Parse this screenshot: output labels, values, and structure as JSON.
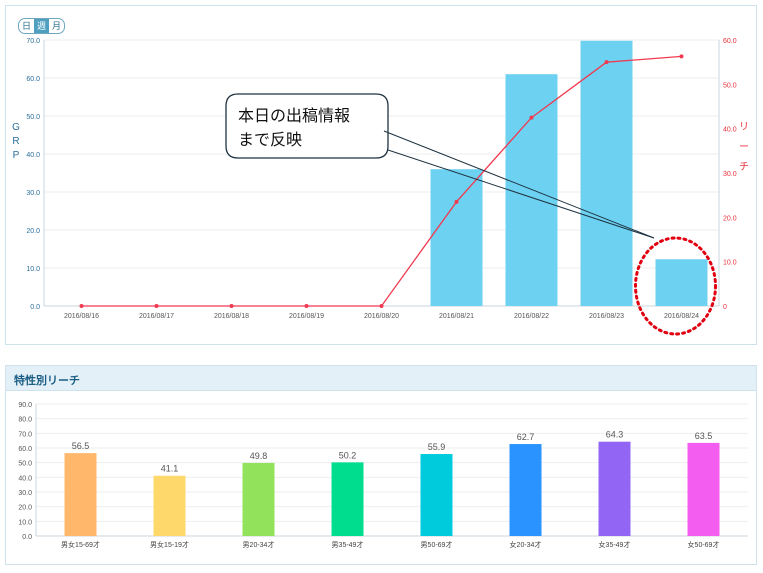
{
  "chart_data": [
    {
      "type": "bar+line",
      "title": "",
      "toggle": {
        "options": [
          "日",
          "週",
          "月"
        ],
        "selected": "週"
      },
      "categories": [
        "2016/08/16",
        "2016/08/17",
        "2016/08/18",
        "2016/08/19",
        "2016/08/20",
        "2016/08/21",
        "2016/08/22",
        "2016/08/23",
        "2016/08/24"
      ],
      "series": [
        {
          "name": "GRP",
          "type": "bar",
          "axis": "left",
          "values": [
            0,
            0,
            0,
            0,
            0,
            36.0,
            61.0,
            69.8,
            12.3
          ]
        },
        {
          "name": "リーチ",
          "type": "line",
          "axis": "right",
          "values": [
            0,
            0,
            0,
            0,
            0,
            23.5,
            42.5,
            55.0,
            56.3
          ]
        }
      ],
      "ylabel": "GRP",
      "ylabel_right": "リーチ",
      "ylim": [
        0,
        70
      ],
      "ylim_right": [
        0,
        60
      ],
      "yticks": [
        "0.0",
        "10.0",
        "20.0",
        "30.0",
        "40.0",
        "50.0",
        "60.0",
        "70.0"
      ],
      "yticks_right": [
        "0",
        "10.0",
        "20.0",
        "30.0",
        "40.0",
        "50.0",
        "60.0"
      ],
      "colors": {
        "bar": "#6dd1f2",
        "line": "#f03a50",
        "left_axis": "#2b6f9a",
        "right_axis": "#e8323c"
      },
      "annotation": {
        "lines": [
          "本日の出稿情報",
          "まで反映"
        ],
        "highlighted_category": "2016/08/24"
      }
    },
    {
      "type": "bar",
      "title": "特性別リーチ",
      "categories": [
        "男女15-69才",
        "男女15-19才",
        "男20-34才",
        "男35-49才",
        "男50-69才",
        "女20-34才",
        "女35-49才",
        "女50-69才"
      ],
      "values": [
        56.5,
        41.1,
        49.8,
        50.2,
        55.9,
        62.7,
        64.3,
        63.5
      ],
      "value_labels": [
        "56.5",
        "41.1",
        "49.8",
        "50.2",
        "55.9",
        "62.7",
        "64.3",
        "63.5"
      ],
      "ylim": [
        0,
        90
      ],
      "yticks": [
        "0.0",
        "10.0",
        "20.0",
        "30.0",
        "40.0",
        "50.0",
        "60.0",
        "70.0",
        "80.0",
        "90.0"
      ],
      "colors": [
        "#ffb86b",
        "#ffd86b",
        "#92e35b",
        "#00dd8e",
        "#00cbdc",
        "#2a93ff",
        "#9265f5",
        "#f45ef0"
      ]
    }
  ]
}
